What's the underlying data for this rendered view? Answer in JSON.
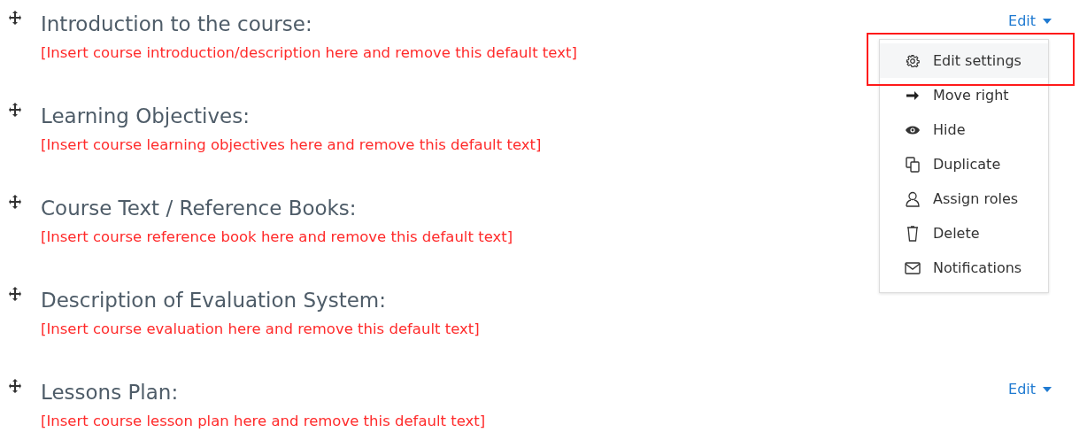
{
  "sections": [
    {
      "title": "Introduction to the course:",
      "description": "[Insert course introduction/description here and remove this default text]",
      "edit": "Edit"
    },
    {
      "title": "Learning Objectives:",
      "description": "[Insert course learning objectives here and remove this default text]"
    },
    {
      "title": "Course Text / Reference Books:",
      "description": "[Insert course reference book here and remove this default text]"
    },
    {
      "title": "Description of Evaluation System:",
      "description": "[Insert course evaluation here and remove this default text]"
    },
    {
      "title": "Lessons Plan:",
      "description": "[Insert course lesson plan here and remove this default text]",
      "edit": "Edit"
    }
  ],
  "edit_menu": {
    "items": [
      {
        "kind": "settings",
        "label": "Edit settings",
        "highlighted": true
      },
      {
        "kind": "move",
        "label": "Move right",
        "highlighted": false
      },
      {
        "kind": "hide",
        "label": "Hide",
        "highlighted": false
      },
      {
        "kind": "duplicate",
        "label": "Duplicate",
        "highlighted": false
      },
      {
        "kind": "roles",
        "label": "Assign roles",
        "highlighted": false
      },
      {
        "kind": "delete",
        "label": "Delete",
        "highlighted": false
      },
      {
        "kind": "notifications",
        "label": "Notifications",
        "highlighted": false
      }
    ]
  }
}
